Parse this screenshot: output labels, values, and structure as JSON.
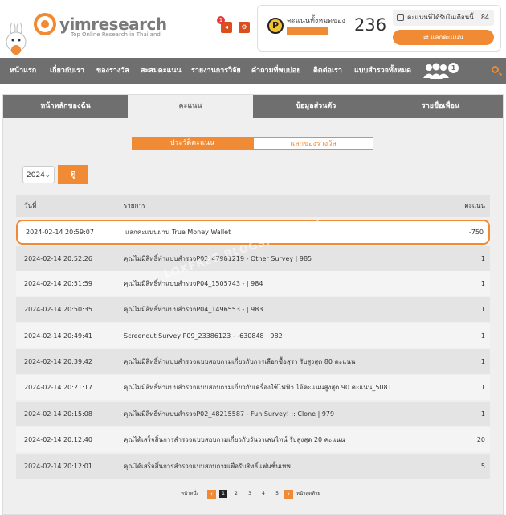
{
  "header": {
    "logo_text": "yimresearch",
    "logo_sub": "Top Online Research in Thailand",
    "notif_count": "1",
    "points": {
      "label": "คะแนนทั้งหมดของ",
      "total": "236",
      "month_label": "คะแนนที่ได้รับในเดือนนี้",
      "month_value": "84",
      "redeem_label": "แลกคะแนน"
    }
  },
  "nav": {
    "items": [
      "หน้าแรก",
      "เกี่ยวกับเรา",
      "ของรางวัล",
      "สะสมคะแนน",
      "รายงานการวิจัย",
      "คำถามที่พบบ่อย",
      "ติดต่อเรา",
      "แบบสำรวจทั้งหมด"
    ],
    "badge": "1"
  },
  "tabs": [
    "หน้าหลักของฉัน",
    "คะแนน",
    "ข้อมูลส่วนตัว",
    "รายชื่อเพื่อน"
  ],
  "segments": {
    "history": "ประวัติคะแนน",
    "rewards": "แลกของรางวัล"
  },
  "filter": {
    "year": "2024",
    "go": "ดู"
  },
  "table": {
    "headers": {
      "date": "วันที่",
      "item": "รายการ",
      "points": "คะแนน"
    },
    "rows": [
      {
        "date": "2024-02-14 20:59:07",
        "item": "แลกคะแนนผ่าน True Money Wallet",
        "points": "-750"
      },
      {
        "date": "2024-02-14 20:52:26",
        "item": "คุณไม่มีสิทธิ์ทำแบบสำรวจP02_47981219 - Other Survey | 985",
        "points": "1"
      },
      {
        "date": "2024-02-14 20:51:59",
        "item": "คุณไม่มีสิทธิ์ทำแบบสำรวจP04_1505743 - | 984",
        "points": "1"
      },
      {
        "date": "2024-02-14 20:50:35",
        "item": "คุณไม่มีสิทธิ์ทำแบบสำรวจP04_1496553 - | 983",
        "points": "1"
      },
      {
        "date": "2024-02-14 20:49:41",
        "item": "Screenout Survey P09_23386123 - -630848 | 982",
        "points": "1"
      },
      {
        "date": "2024-02-14 20:39:42",
        "item": "คุณไม่มีสิทธิ์ทำแบบสำรวจแบบสอบถามเกี่ยวกับการเลือกซื้อสุรา รับสูงสุด 80 คะแนน",
        "points": "1"
      },
      {
        "date": "2024-02-14 20:21:17",
        "item": "คุณไม่มีสิทธิ์ทำแบบสำรวจแบบสอบถามเกี่ยวกับเครื่องใช้ไฟฟ้า ได้คะแนนสูงสุด 90 คะแนน_5081",
        "points": "1"
      },
      {
        "date": "2024-02-14 20:15:08",
        "item": "คุณไม่มีสิทธิ์ทำแบบสำรวจP02_48215587 - Fun Survey! :: Clone | 979",
        "points": "1"
      },
      {
        "date": "2024-02-14 20:12:40",
        "item": "คุณได้เสร็จสิ้นการสำรวจแบบสอบถามเกี่ยวกับวันวาเลนไทน์ รับสูงสุด 20 คะแนน",
        "points": "20"
      },
      {
        "date": "2024-02-14 20:12:01",
        "item": "คุณได้เสร็จสิ้นการสำรวจแบบสอบถามเพื่อรับสิทธิ์แฟนชั้นเทพ",
        "points": "5"
      }
    ]
  },
  "pager": {
    "first": "หน้าหนึ่ง",
    "pages": [
      "1",
      "2",
      "3",
      "4",
      "5"
    ],
    "current": "1",
    "last": "หน้าสุดท้าย"
  },
  "watermark": "LOKFREE.BLOGSPOT.COM",
  "colors": {
    "accent": "#f08a34",
    "nav": "#6f6f6f"
  },
  "icons": {
    "coin": "P",
    "prev": "‹",
    "next": "›"
  }
}
